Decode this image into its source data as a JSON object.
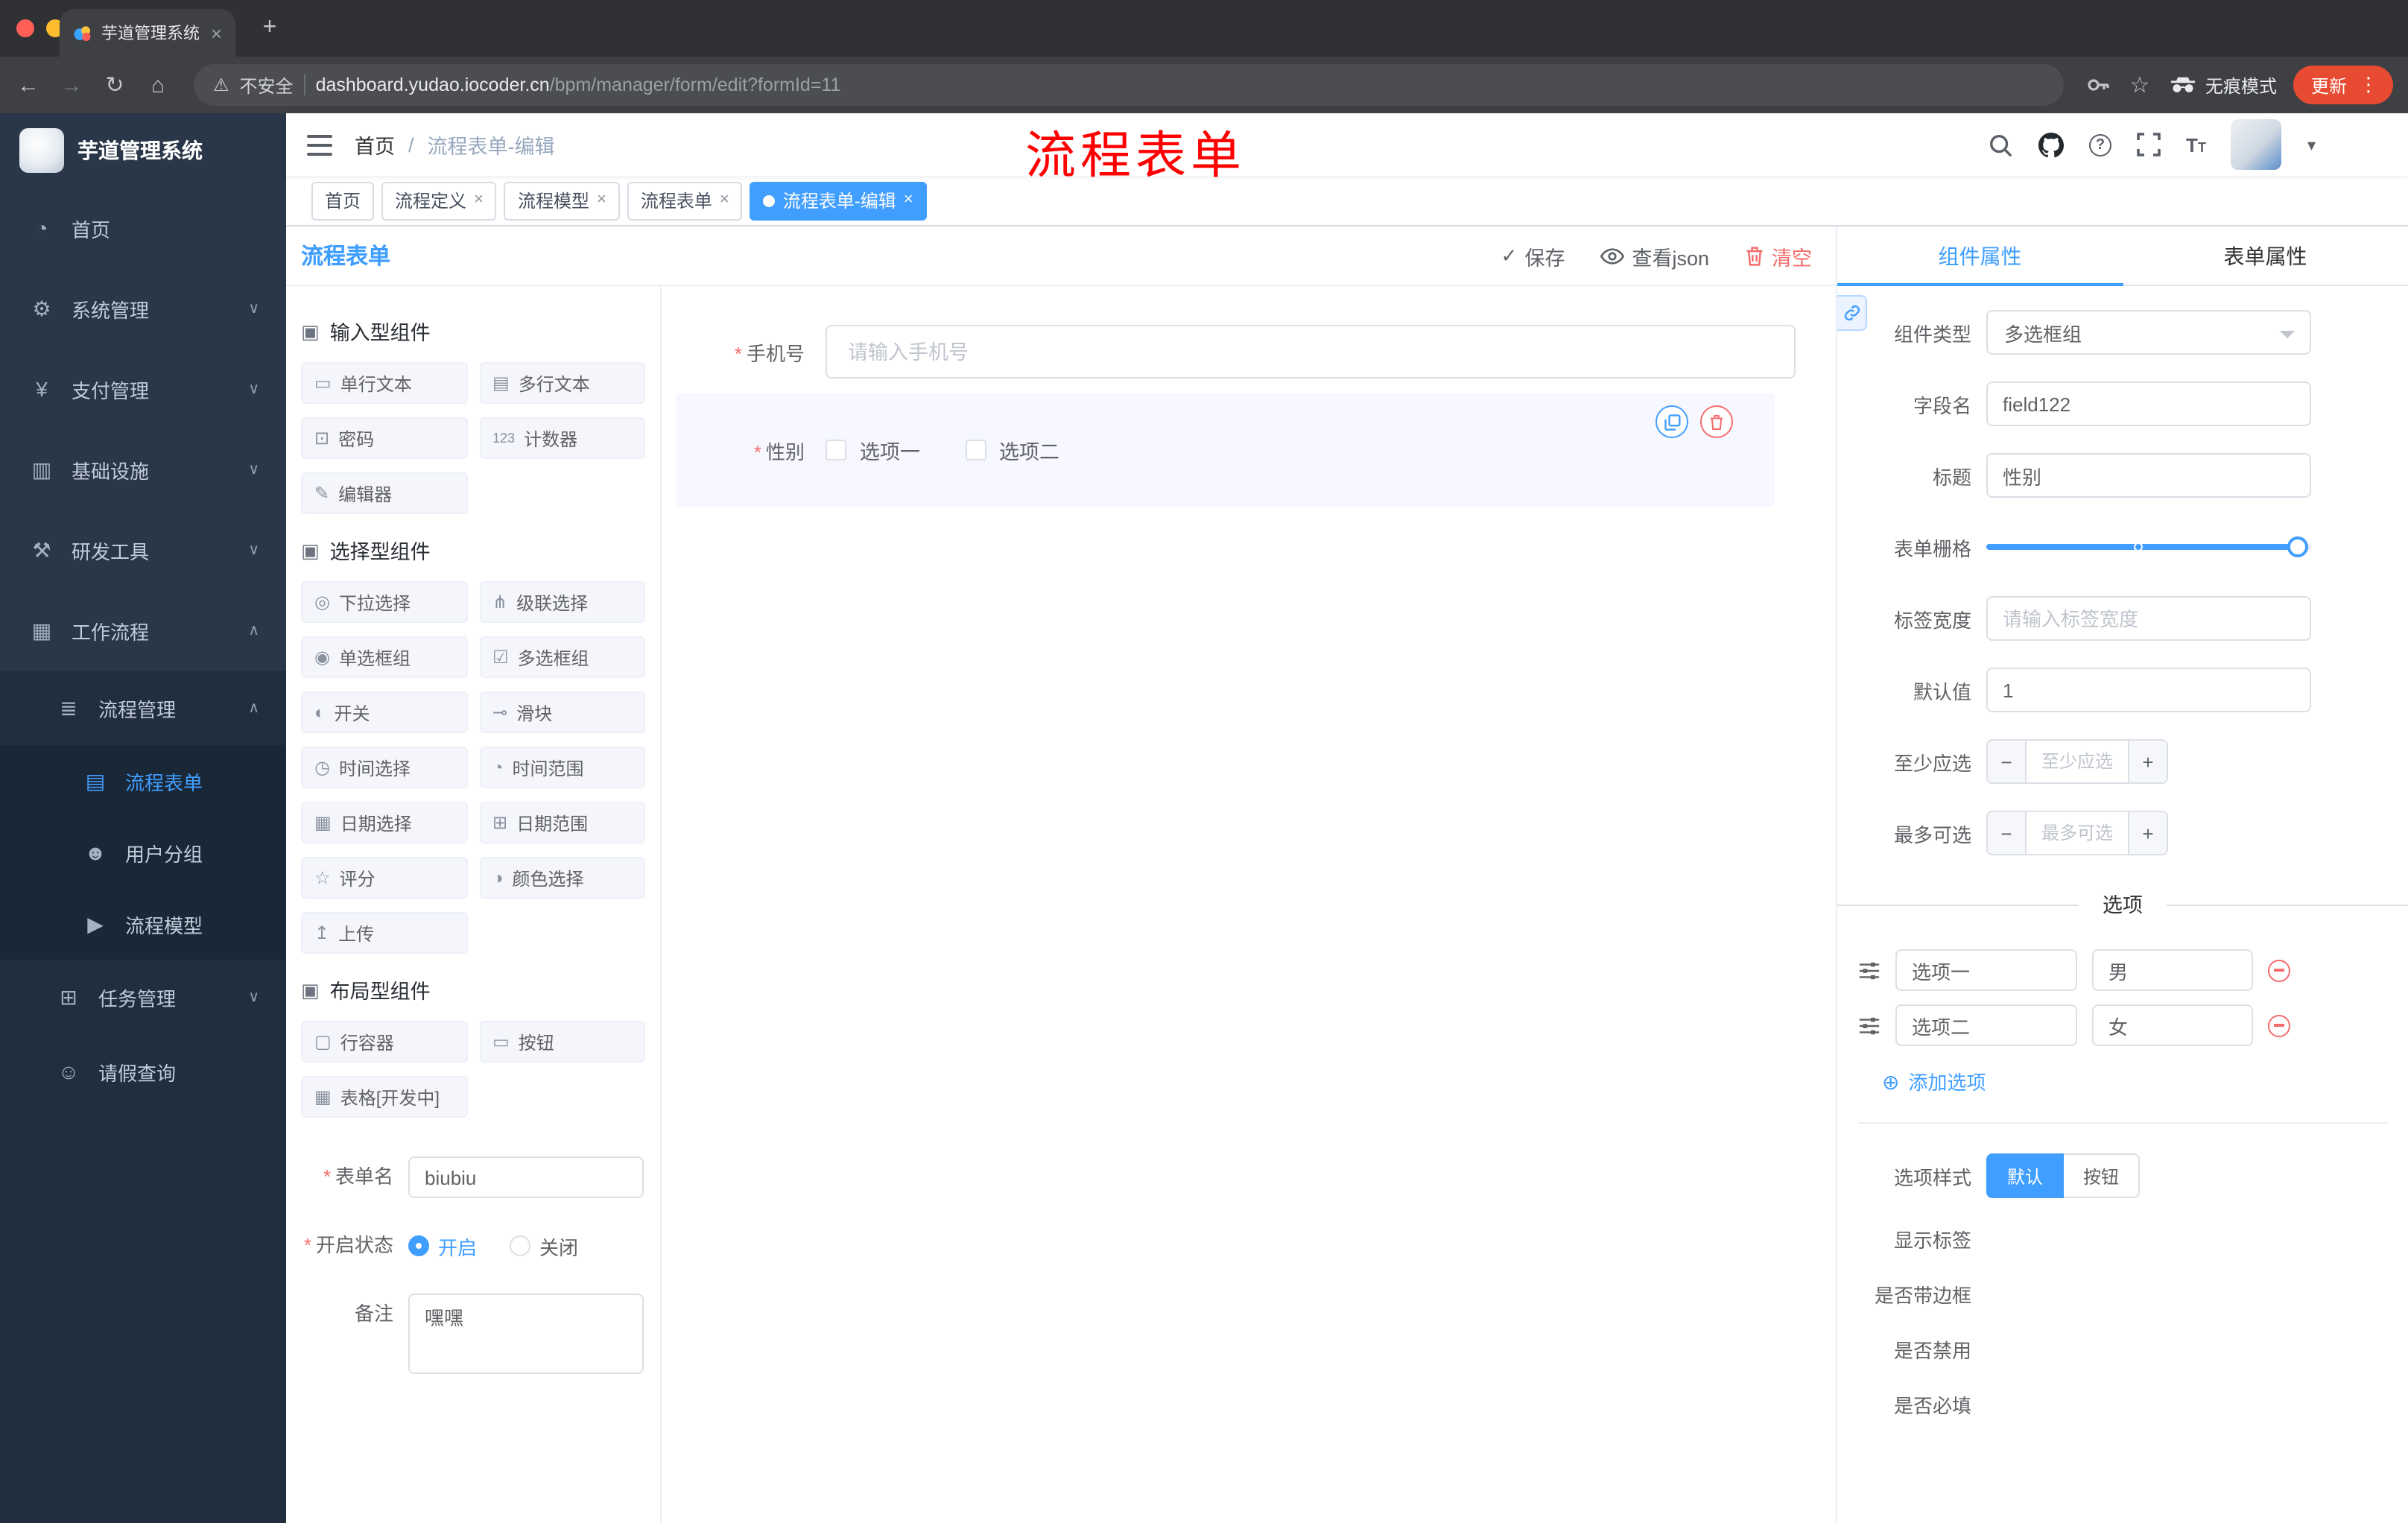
{
  "colors": {
    "accent": "#409eff",
    "danger": "#f56c6c",
    "annotation_red": "#ff0000",
    "update_pill": "#e74b31",
    "active_tag": "#409eff"
  },
  "icons": {
    "close-icon": "×",
    "plus-icon": "+",
    "kebab-icon": "⋮",
    "back-icon": "←",
    "forward-icon": "→",
    "reload-icon": "↻",
    "home-icon": "⌂",
    "warning-icon": "⚠",
    "star-icon": "☆",
    "caret-down-icon": "▾",
    "chevron-down": "∨",
    "chevron-up": "∧",
    "check-icon": "✓",
    "add-circle-icon": "⊕",
    "dashboard-icon": "◔",
    "system-icon": "⚙",
    "payment-icon": "¥",
    "infrastructure-icon": "▥",
    "devtools-icon": "⚒",
    "workflow-icon": "▦",
    "process-management-icon": "≣",
    "process-form-icon": "▤",
    "user-group-icon": "☻",
    "process-model-icon": "▶",
    "task-management-icon": "⊞",
    "leave-query-icon": "☺",
    "section-icon": "▣",
    "single-line-text-icon": "▭",
    "multi-line-text-icon": "▤",
    "password-icon": "⊡",
    "counter-icon": "123",
    "editor-icon": "✎",
    "select-icon": "◎",
    "cascader-icon": "⋔",
    "radio-group-icon": "◉",
    "checkbox-group-icon": "☑",
    "switch-icon": "◐",
    "slider-icon": "⊸",
    "time-picker-icon": "◷",
    "time-range-icon": "◔",
    "date-picker-icon": "▦",
    "date-range-icon": "⊞",
    "rate-icon": "☆",
    "color-picker-icon": "◑",
    "upload-icon": "↥",
    "row-container-icon": "▢",
    "button-icon": "▭",
    "table-icon": "▦"
  },
  "browser": {
    "tab": {
      "title": "芋道管理系统"
    },
    "address": {
      "security_label": "不安全",
      "url_host": "dashboard.yudao.iocoder.cn",
      "url_path": "/bpm/manager/form/edit?formId=11"
    },
    "incognito_label": "无痕模式",
    "update_label": "更新"
  },
  "sidebar": {
    "logo_title": "芋道管理系统",
    "items": [
      {
        "label": "首页",
        "icon": "dashboard-icon"
      },
      {
        "label": "系统管理",
        "icon": "system-icon"
      },
      {
        "label": "支付管理",
        "icon": "payment-icon"
      },
      {
        "label": "基础设施",
        "icon": "infrastructure-icon"
      },
      {
        "label": "研发工具",
        "icon": "devtools-icon"
      },
      {
        "label": "工作流程",
        "icon": "workflow-icon"
      },
      {
        "label": "流程管理",
        "icon": "process-management-icon"
      },
      {
        "label": "流程表单",
        "icon": "process-form-icon",
        "active": true
      },
      {
        "label": "用户分组",
        "icon": "user-group-icon"
      },
      {
        "label": "流程模型",
        "icon": "process-model-icon"
      },
      {
        "label": "任务管理",
        "icon": "task-management-icon"
      },
      {
        "label": "请假查询",
        "icon": "leave-query-icon"
      }
    ]
  },
  "header": {
    "breadcrumb": {
      "root": "首页",
      "separator": "/",
      "current": "流程表单-编辑"
    },
    "annotation": "流程表单"
  },
  "tags": [
    {
      "label": "首页"
    },
    {
      "label": "流程定义"
    },
    {
      "label": "流程模型"
    },
    {
      "label": "流程表单"
    },
    {
      "label": "流程表单-编辑"
    }
  ],
  "designer": {
    "title": "流程表单",
    "actions": {
      "save": "保存",
      "view_json": "查看json",
      "clear": "清空"
    },
    "palette": {
      "sections": [
        {
          "title": "输入型组件",
          "items": [
            {
              "label": "单行文本",
              "icon": "single-line-text-icon"
            },
            {
              "label": "多行文本",
              "icon": "multi-line-text-icon"
            },
            {
              "label": "密码",
              "icon": "password-icon"
            },
            {
              "label": "计数器",
              "icon": "counter-icon"
            },
            {
              "label": "编辑器",
              "icon": "editor-icon"
            }
          ]
        },
        {
          "title": "选择型组件",
          "items": [
            {
              "label": "下拉选择",
              "icon": "select-icon"
            },
            {
              "label": "级联选择",
              "icon": "cascader-icon"
            },
            {
              "label": "单选框组",
              "icon": "radio-group-icon"
            },
            {
              "label": "多选框组",
              "icon": "checkbox-group-icon"
            },
            {
              "label": "开关",
              "icon": "switch-icon"
            },
            {
              "label": "滑块",
              "icon": "slider-icon"
            },
            {
              "label": "时间选择",
              "icon": "time-picker-icon"
            },
            {
              "label": "时间范围",
              "icon": "time-range-icon"
            },
            {
              "label": "日期选择",
              "icon": "date-picker-icon"
            },
            {
              "label": "日期范围",
              "icon": "date-range-icon"
            },
            {
              "label": "评分",
              "icon": "rate-icon"
            },
            {
              "label": "颜色选择",
              "icon": "color-picker-icon"
            },
            {
              "label": "上传",
              "icon": "upload-icon"
            }
          ]
        },
        {
          "title": "布局型组件",
          "items": [
            {
              "label": "行容器",
              "icon": "row-container-icon"
            },
            {
              "label": "按钮",
              "icon": "button-icon"
            },
            {
              "label": "表格[开发中]",
              "icon": "table-icon"
            }
          ]
        }
      ]
    },
    "meta": {
      "form_name_label": "表单名",
      "form_name_value": "biubiu",
      "status_label": "开启状态",
      "status_on": "开启",
      "status_off": "关闭",
      "remark_label": "备注",
      "remark_value": "嘿嘿"
    },
    "canvas": {
      "phone_label": "手机号",
      "phone_placeholder": "请输入手机号",
      "gender_label": "性别",
      "gender_option1": "选项一",
      "gender_option2": "选项二"
    }
  },
  "props": {
    "tab_component": "组件属性",
    "tab_form": "表单属性",
    "component_type_label": "组件类型",
    "component_type_value": "多选框组",
    "field_name_label": "字段名",
    "field_name_value": "field122",
    "title_label": "标题",
    "title_value": "性别",
    "grid_label": "表单栅格",
    "label_width_label": "标签宽度",
    "label_width_placeholder": "请输入标签宽度",
    "default_label": "默认值",
    "default_value": "1",
    "min_label": "至少应选",
    "min_placeholder": "至少应选",
    "max_label": "最多可选",
    "max_placeholder": "最多可选",
    "options_title": "选项",
    "options": [
      {
        "label": "选项一",
        "value": "男"
      },
      {
        "label": "选项二",
        "value": "女"
      }
    ],
    "add_option": "添加选项",
    "style_label": "选项样式",
    "style_default": "默认",
    "style_button": "按钮",
    "switch_rows": [
      {
        "label": "显示标签",
        "on": true
      },
      {
        "label": "是否带边框",
        "on": false
      },
      {
        "label": "是否禁用",
        "on": false
      },
      {
        "label": "是否必填",
        "on": true
      }
    ]
  }
}
